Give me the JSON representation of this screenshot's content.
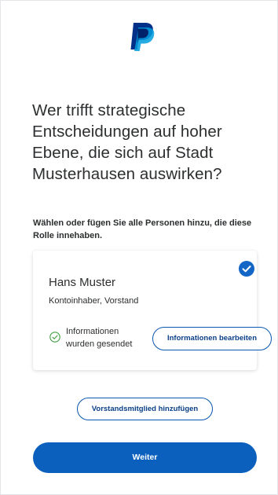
{
  "brand": {
    "logo_icon": "paypal-logo-icon",
    "primary_color": "#0b5fbd",
    "dark_color": "#003087"
  },
  "question": "Wer trifft strategische Entscheidungen auf hoher Ebene, die sich auf Stadt Musterhausen auswirken?",
  "instruction": "Wählen oder fügen Sie alle Personen hinzu, die diese Rolle innehaben.",
  "person": {
    "name": "Hans Muster",
    "role": "Kontoinhaber, Vorstand",
    "selected": true,
    "status_icon": "check-circle-icon",
    "status_text": "Informationen wurden gesendet",
    "edit_label": "Informationen bearbeiten"
  },
  "add_member_label": "Vorstandsmitglied hinzufügen",
  "continue_label": "Weiter"
}
